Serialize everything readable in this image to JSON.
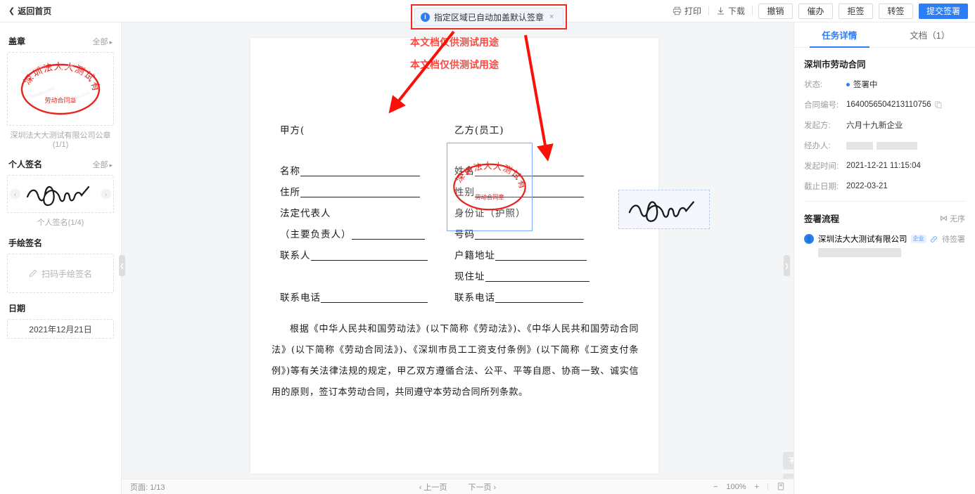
{
  "topbar": {
    "back_label": "返回首页",
    "print_label": "打印",
    "download_label": "下载",
    "buttons": [
      {
        "label": "撤销",
        "primary": false
      },
      {
        "label": "催办",
        "primary": false
      },
      {
        "label": "拒签",
        "primary": false
      },
      {
        "label": "转签",
        "primary": false
      },
      {
        "label": "提交签署",
        "primary": true
      }
    ],
    "accent_color": "#2d7df6"
  },
  "toast": {
    "message": "指定区域已自动加盖默认签章",
    "close_label": "×",
    "highlight_color": "#ee2b22"
  },
  "sidebar": {
    "seal_section": {
      "title": "盖章",
      "all_label": "全部",
      "caption": "深圳法大大测试有限公司公章(1/1)",
      "seal_outer_text": "深圳法大大测试有限公司",
      "seal_inner_text": "劳动合同章",
      "seal_color": "#e8231c",
      "watermark": "fadada.com"
    },
    "personal_sign_section": {
      "title": "个人签名",
      "all_label": "全部",
      "caption": "个人签名(1/4)",
      "prev_label": "‹",
      "next_label": "›"
    },
    "hand_sign_section": {
      "title": "手绘签名",
      "action_label": "扫码手绘签名"
    },
    "date_section": {
      "title": "日期",
      "value": "2021年12月21日"
    }
  },
  "document": {
    "watermark_text": "本文档仅供测试用途",
    "party_a_label": "甲方(",
    "party_b_label": "乙方(员工)",
    "fields_left": [
      "名称",
      "住所",
      "法定代表人",
      "（主要负责人）",
      "联系人",
      "联系电话"
    ],
    "fields_right": [
      "姓名",
      "性别",
      "身份证（护照）",
      "号码",
      "户籍地址",
      "现住址",
      "联系电话"
    ],
    "paragraph": "根据《中华人民共和国劳动法》(以下简称《劳动法》)、《中华人民共和国劳动合同法》(以下简称《劳动合同法》)、《深圳市员工工资支付条例》(以下简称《工资支付条例》)等有关法律法规的规定，甲乙双方遵循合法、公平、平等自愿、协商一致、诚实信用的原则，签订本劳动合同，共同遵守本劳动合同所列条款。",
    "stamped_seal_outer": "深圳法大大测试有限公司",
    "stamped_seal_inner": "劳动合同章"
  },
  "bottombar": {
    "page_label": "页面: 1/13",
    "prev_page": "‹ 上一页",
    "next_page": "下一页 ›",
    "zoom_out": "−",
    "zoom_level": "100%",
    "zoom_in": "+"
  },
  "rightpanel": {
    "tabs": [
      {
        "label": "任务详情",
        "active": true
      },
      {
        "label": "文档（1）",
        "active": false
      }
    ],
    "doc_title": "深圳市劳动合同",
    "details": [
      {
        "label": "状态:",
        "value": "签署中",
        "type": "status"
      },
      {
        "label": "合同编号:",
        "value": "1640056504213110756",
        "type": "copyable"
      },
      {
        "label": "发起方:",
        "value": "六月十九新企业",
        "type": "text"
      },
      {
        "label": "经办人:",
        "value": "",
        "type": "redacted"
      },
      {
        "label": "发起时间:",
        "value": "2021-12-21 11:15:04",
        "type": "text"
      },
      {
        "label": "截止日期:",
        "value": "2022-03-21",
        "type": "text"
      }
    ],
    "flow": {
      "title": "签署流程",
      "order_label": "无序",
      "signer_name": "深圳法大大测试有限公司",
      "signer_badge": "企业",
      "signer_status": "待签署"
    }
  }
}
